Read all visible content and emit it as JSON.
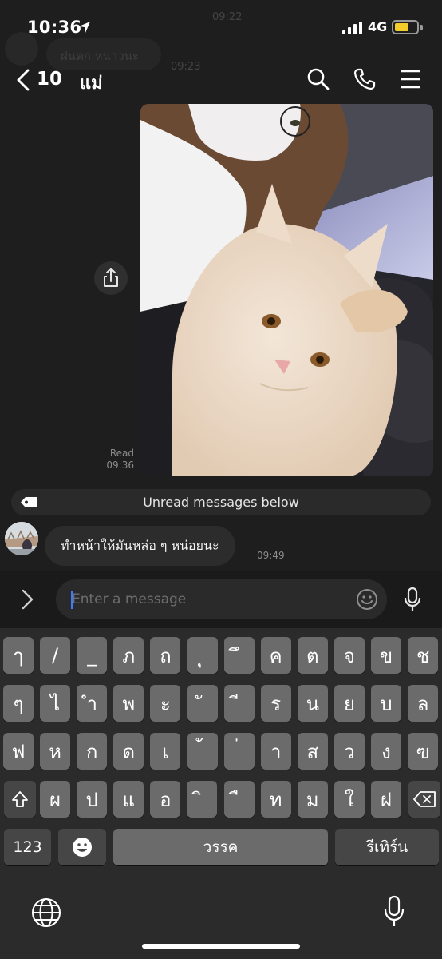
{
  "status_bar": {
    "time": "10:36",
    "network": "4G",
    "battery_level": 0.65,
    "battery_color": "#f2cc2b"
  },
  "ghost": {
    "time_top": "09:22",
    "bubble_text": "ฝนตก หนาวนะ",
    "time_mid": "09:23"
  },
  "header": {
    "back_count": "10",
    "title": "แม่"
  },
  "photo_message": {
    "read_label": "Read",
    "time": "09:36"
  },
  "unread_banner": {
    "text": "Unread messages below"
  },
  "incoming_message": {
    "text": "ทำหน้าให้มันหล่อ ๆ หน่อยนะ",
    "time": "09:49"
  },
  "composer": {
    "placeholder": "Enter a message",
    "value": ""
  },
  "keyboard": {
    "row1": [
      "ๅ",
      "/",
      "_",
      "ภ",
      "ถ",
      "ุ",
      "ึ",
      "ค",
      "ต",
      "จ",
      "ข",
      "ช"
    ],
    "row2": [
      "ๆ",
      "ไ",
      "ำ",
      "พ",
      "ะ",
      "ั",
      "ี",
      "ร",
      "น",
      "ย",
      "บ",
      "ล"
    ],
    "row3": [
      "ฟ",
      "ห",
      "ก",
      "ด",
      "เ",
      "้",
      "่",
      "า",
      "ส",
      "ว",
      "ง",
      "ฃ"
    ],
    "row4": [
      "ผ",
      "ป",
      "แ",
      "อ",
      "ิ",
      "ื",
      "ท",
      "ม",
      "ใ",
      "ฝ"
    ],
    "numbers_key": "123",
    "space_key": "วรรค",
    "return_key": "รีเทิร์น"
  },
  "colors": {
    "background": "#1e1e1e",
    "key": "#6b6b6b",
    "key_dark": "#464646",
    "caret": "#3d7bff"
  }
}
